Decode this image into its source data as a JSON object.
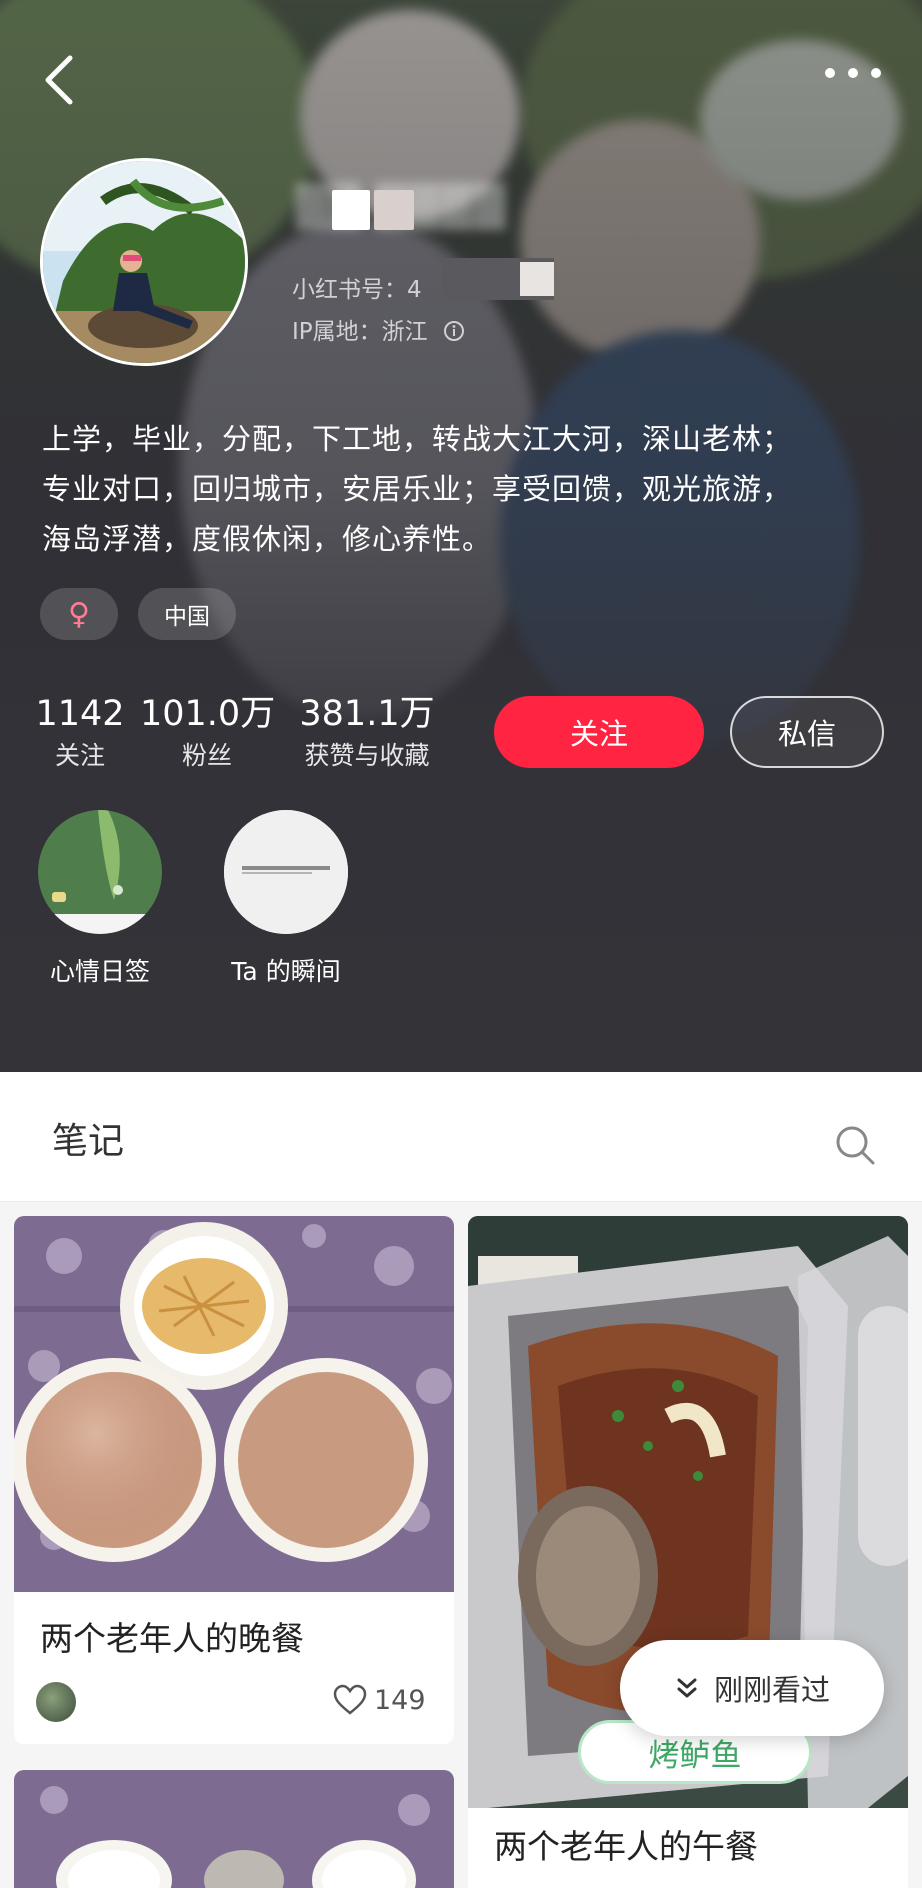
{
  "header": {
    "user_id_label": "小红书号：4",
    "ip_label": "IP属地：浙江",
    "bio_lines": [
      "上学，毕业，分配，下工地，转战大江大河，深山老林；",
      "专业对口，回归城市，安居乐业；享受回馈，观光旅游，",
      "海岛浮潜，度假休闲，修心养性。"
    ],
    "tags": {
      "gender": "♀",
      "region": "中国"
    },
    "stats": [
      {
        "value": "1142",
        "label": "关注"
      },
      {
        "value": "101.0万",
        "label": "粉丝"
      },
      {
        "value": "381.1万",
        "label": "获赞与收藏"
      }
    ],
    "follow_label": "关注",
    "message_label": "私信",
    "stories": [
      {
        "label": "心情日签"
      },
      {
        "label": "Ta 的瞬间"
      }
    ]
  },
  "notes": {
    "tab_label": "笔记",
    "search_icon": "search-icon"
  },
  "feed": {
    "cards": [
      {
        "title": "两个老年人的晚餐",
        "likes": "149"
      },
      {
        "title": "两个老年人的午餐",
        "tag": "烤鲈鱼"
      }
    ],
    "recent_label": "刚刚看过"
  },
  "colors": {
    "accent": "#ff2442",
    "tag_green": "#3fa866"
  }
}
